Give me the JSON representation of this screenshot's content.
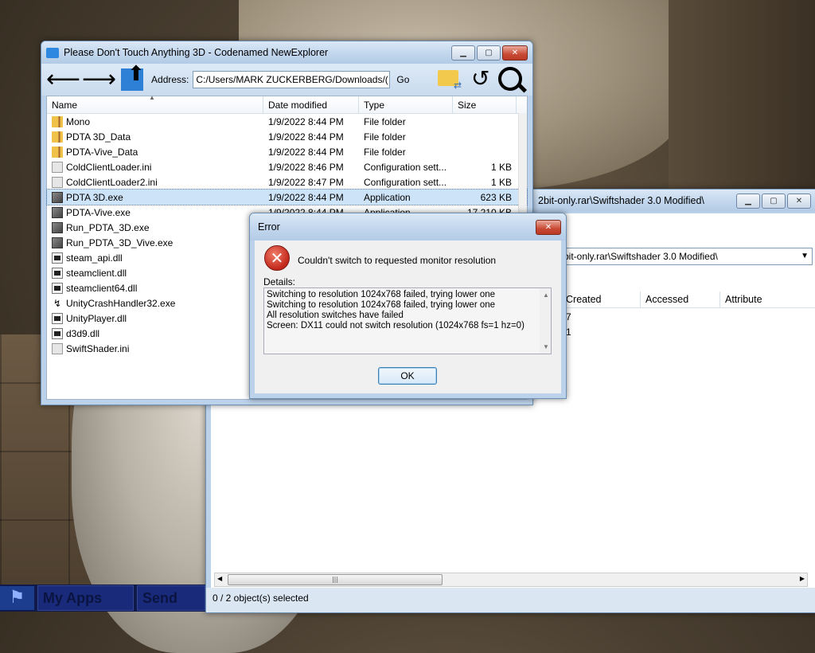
{
  "explorer": {
    "title": "Please Don't Touch Anything 3D - Codenamed NewExplorer",
    "address_label": "Address:",
    "address_value": "C:/Users/MARK ZUCKERBERG/Downloads/(",
    "go_label": "Go",
    "columns": {
      "name": "Name",
      "date": "Date modified",
      "type": "Type",
      "size": "Size"
    },
    "files": [
      {
        "name": "Mono",
        "date": "1/9/2022 8:44 PM",
        "type": "File folder",
        "size": "",
        "icon": "folder-icon"
      },
      {
        "name": "PDTA 3D_Data",
        "date": "1/9/2022 8:44 PM",
        "type": "File folder",
        "size": "",
        "icon": "folder-icon"
      },
      {
        "name": "PDTA-Vive_Data",
        "date": "1/9/2022 8:44 PM",
        "type": "File folder",
        "size": "",
        "icon": "folder-icon"
      },
      {
        "name": "ColdClientLoader.ini",
        "date": "1/9/2022 8:46 PM",
        "type": "Configuration sett...",
        "size": "1 KB",
        "icon": "ini-file-icon"
      },
      {
        "name": "ColdClientLoader2.ini",
        "date": "1/9/2022 8:47 PM",
        "type": "Configuration sett...",
        "size": "1 KB",
        "icon": "ini-file-icon"
      },
      {
        "name": "PDTA 3D.exe",
        "date": "1/9/2022 8:44 PM",
        "type": "Application",
        "size": "623 KB",
        "icon": "exe-icon"
      },
      {
        "name": "PDTA-Vive.exe",
        "date": "1/9/2022 8:44 PM",
        "type": "Application",
        "size": "17,210 KB",
        "icon": "exe-icon"
      },
      {
        "name": "Run_PDTA_3D.exe",
        "date": "",
        "type": "",
        "size": "",
        "icon": "exe-icon"
      },
      {
        "name": "Run_PDTA_3D_Vive.exe",
        "date": "",
        "type": "",
        "size": "",
        "icon": "exe-icon"
      },
      {
        "name": "steam_api.dll",
        "date": "",
        "type": "",
        "size": "",
        "icon": "dll-icon"
      },
      {
        "name": "steamclient.dll",
        "date": "",
        "type": "",
        "size": "",
        "icon": "dll-icon"
      },
      {
        "name": "steamclient64.dll",
        "date": "",
        "type": "",
        "size": "",
        "icon": "dll-icon"
      },
      {
        "name": "UnityCrashHandler32.exe",
        "date": "",
        "type": "",
        "size": "",
        "icon": "crash-handler-icon"
      },
      {
        "name": "UnityPlayer.dll",
        "date": "",
        "type": "",
        "size": "",
        "icon": "dll-icon"
      },
      {
        "name": "d3d9.dll",
        "date": "",
        "type": "",
        "size": "",
        "icon": "dll-icon"
      },
      {
        "name": "SwiftShader.ini",
        "date": "",
        "type": "",
        "size": "",
        "icon": "ini-file-icon"
      }
    ]
  },
  "back_window": {
    "title": "2bit-only.rar\\Swiftshader 3.0 Modified\\",
    "address_value": "bit-only.rar\\Swiftshader 3.0 Modified\\",
    "columns": [
      "Created",
      "Accessed",
      "Attribute"
    ],
    "partial_rows": [
      "7",
      "1"
    ],
    "status": "0 / 2 object(s) selected"
  },
  "error_dialog": {
    "title": "Error",
    "message": "Couldn't switch to requested monitor resolution",
    "details_label": "Details:",
    "details_lines": [
      "Switching to resolution 1024x768 failed, trying lower one",
      "Switching to resolution 1024x768 failed, trying lower one",
      "All resolution switches have failed",
      "Screen: DX11 could not switch resolution (1024x768 fs=1 hz=0)"
    ],
    "ok_label": "OK"
  },
  "taskbar": {
    "items": [
      "My Apps",
      "Send"
    ]
  }
}
